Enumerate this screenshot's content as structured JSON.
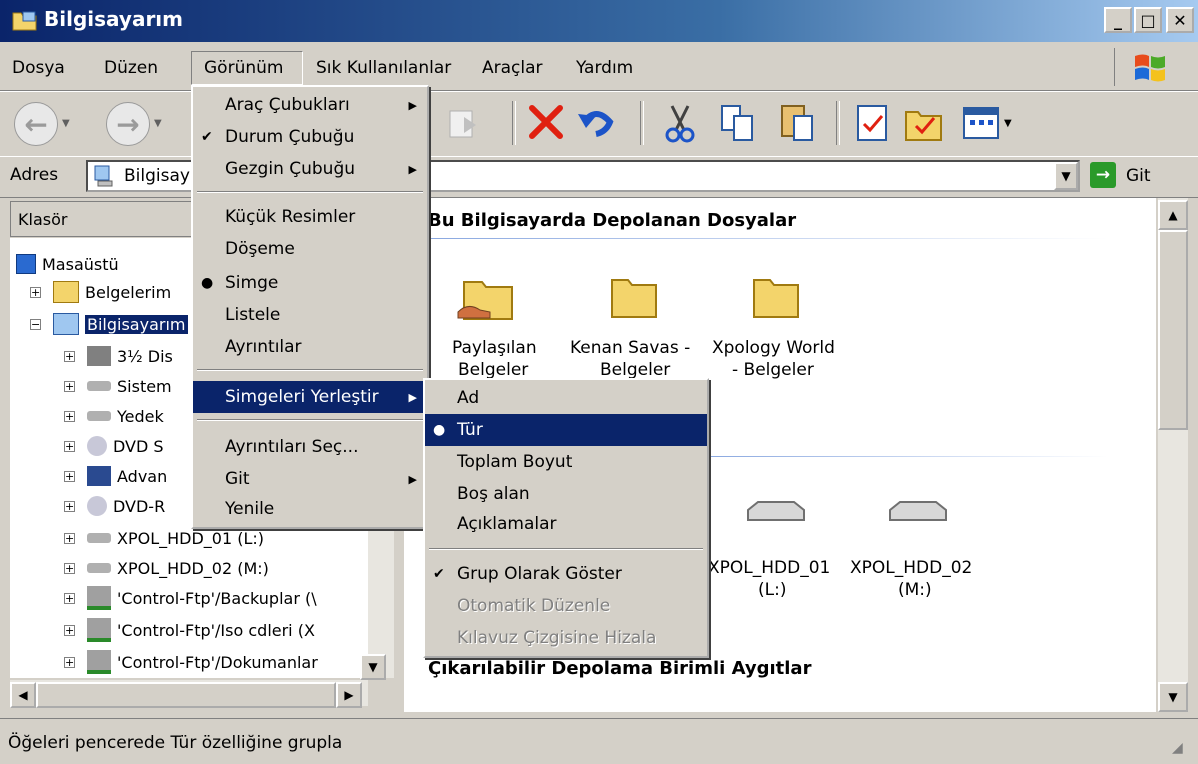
{
  "window": {
    "title": "Bilgisayarım"
  },
  "menubar": [
    "Dosya",
    "Düzen",
    "Görünüm",
    "Sık Kullanılanlar",
    "Araçlar",
    "Yardım"
  ],
  "address": {
    "label": "Adres",
    "value": "Bilgisay",
    "go": "Git"
  },
  "folders": {
    "header": "Klasör",
    "items": [
      "Masaüstü",
      "Belgelerim",
      "Bilgisayarım",
      "3½ Dis",
      "Sistem",
      "Yedek",
      "DVD S",
      "Advan",
      "DVD-R",
      "XPOL_HDD_01 (L:)",
      "XPOL_HDD_02 (M:)",
      "'Control-Ftp'/Backuplar (\\",
      "'Control-Ftp'/Iso cdleri (X",
      "'Control-Ftp'/Dokumanlar"
    ]
  },
  "content": {
    "group_header_files": "Bu Bilgisayarda Depolanan Dosyalar",
    "group_header_removable": "Çıkarılabilir Depolama Birimli Aygıtlar",
    "files": [
      {
        "line1": "Paylaşılan",
        "line2": "Belgeler",
        "icon": "shared-folder-icon"
      },
      {
        "line1": "Kenan Savas -",
        "line2": "Belgeler",
        "icon": "folder-icon"
      },
      {
        "line1": "Xpology World",
        "line2": "- Belgeler",
        "icon": "folder-icon"
      }
    ],
    "drives": [
      {
        "line1": "XPOL_HDD_01",
        "line2": "(L:)",
        "icon": "hard-drive-icon"
      },
      {
        "line1": "XPOL_HDD_02",
        "line2": "(M:)",
        "icon": "hard-drive-icon"
      }
    ]
  },
  "view_menu": {
    "items": [
      "Araç Çubukları",
      "Durum Çubuğu",
      "Gezgin Çubuğu",
      "Küçük Resimler",
      "Döşeme",
      "Simge",
      "Listele",
      "Ayrıntılar",
      "Simgeleri Yerleştir",
      "Ayrıntıları Seç...",
      "Git",
      "Yenile"
    ]
  },
  "arrange_menu": {
    "items": [
      "Ad",
      "Tür",
      "Toplam Boyut",
      "Boş alan",
      "Açıklamalar",
      "Grup Olarak Göster",
      "Otomatik Düzenle",
      "Kılavuz Çizgisine Hizala"
    ]
  },
  "statusbar": {
    "text": "Öğeleri pencerede Tür özelliğine grupla"
  }
}
